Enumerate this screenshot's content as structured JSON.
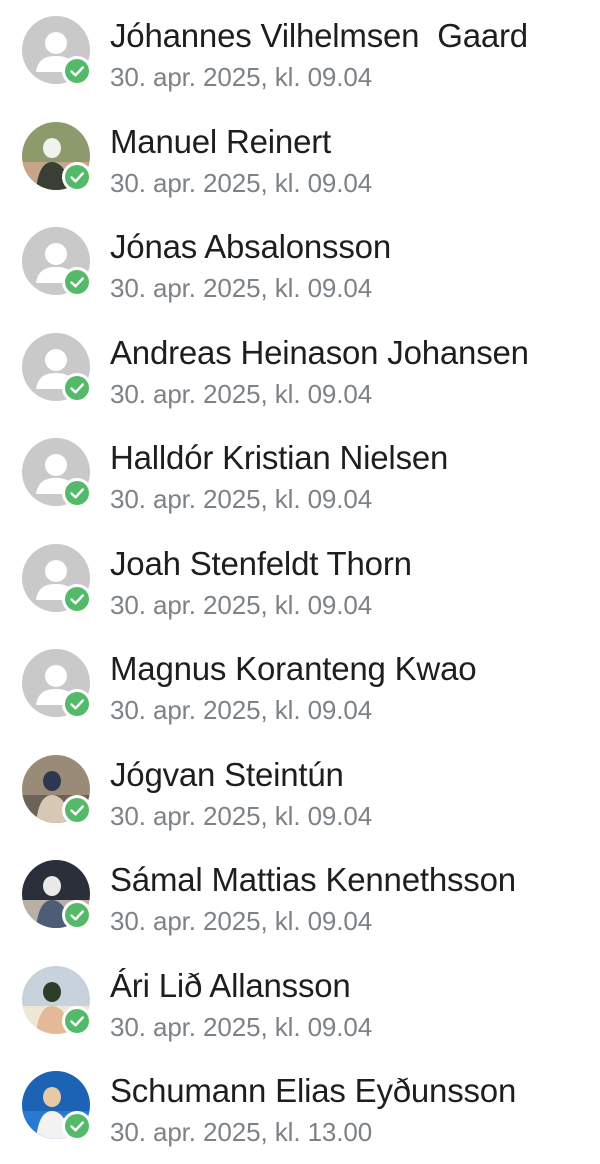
{
  "members": [
    {
      "name": "Jóhannes Vilhelmsen  Gaard",
      "time": "30. apr. 2025, kl. 09.04",
      "avatar": "placeholder",
      "status": "checked"
    },
    {
      "name": "Manuel Reinert",
      "time": "30. apr. 2025, kl. 09.04",
      "avatar": "photo-1",
      "status": "checked"
    },
    {
      "name": "Jónas Absalonsson",
      "time": "30. apr. 2025, kl. 09.04",
      "avatar": "placeholder",
      "status": "checked"
    },
    {
      "name": "Andreas Heinason Johansen",
      "time": "30. apr. 2025, kl. 09.04",
      "avatar": "placeholder",
      "status": "checked"
    },
    {
      "name": "Halldór Kristian Nielsen",
      "time": "30. apr. 2025, kl. 09.04",
      "avatar": "placeholder",
      "status": "checked"
    },
    {
      "name": "Joah Stenfeldt Thorn",
      "time": "30. apr. 2025, kl. 09.04",
      "avatar": "placeholder",
      "status": "checked"
    },
    {
      "name": "Magnus Koranteng Kwao",
      "time": "30. apr. 2025, kl. 09.04",
      "avatar": "placeholder",
      "status": "checked"
    },
    {
      "name": "Jógvan Steintún",
      "time": "30. apr. 2025, kl. 09.04",
      "avatar": "photo-2",
      "status": "checked"
    },
    {
      "name": "Sámal Mattias Kennethsson",
      "time": "30. apr. 2025, kl. 09.04",
      "avatar": "photo-3",
      "status": "checked"
    },
    {
      "name": "Ári Lið Allansson",
      "time": "30. apr. 2025, kl. 09.04",
      "avatar": "photo-4",
      "status": "checked"
    },
    {
      "name": "Schumann Elias Eyðunsson",
      "time": "30. apr. 2025, kl. 13.00",
      "avatar": "photo-5",
      "status": "checked"
    }
  ],
  "colors": {
    "check": "#55b96a",
    "placeholder_bg": "#c9c9c9",
    "name_text": "#1e1e1e",
    "time_text": "#7d8287"
  },
  "icons": {
    "placeholder": "person-placeholder-icon",
    "status": "check-circle-icon"
  }
}
